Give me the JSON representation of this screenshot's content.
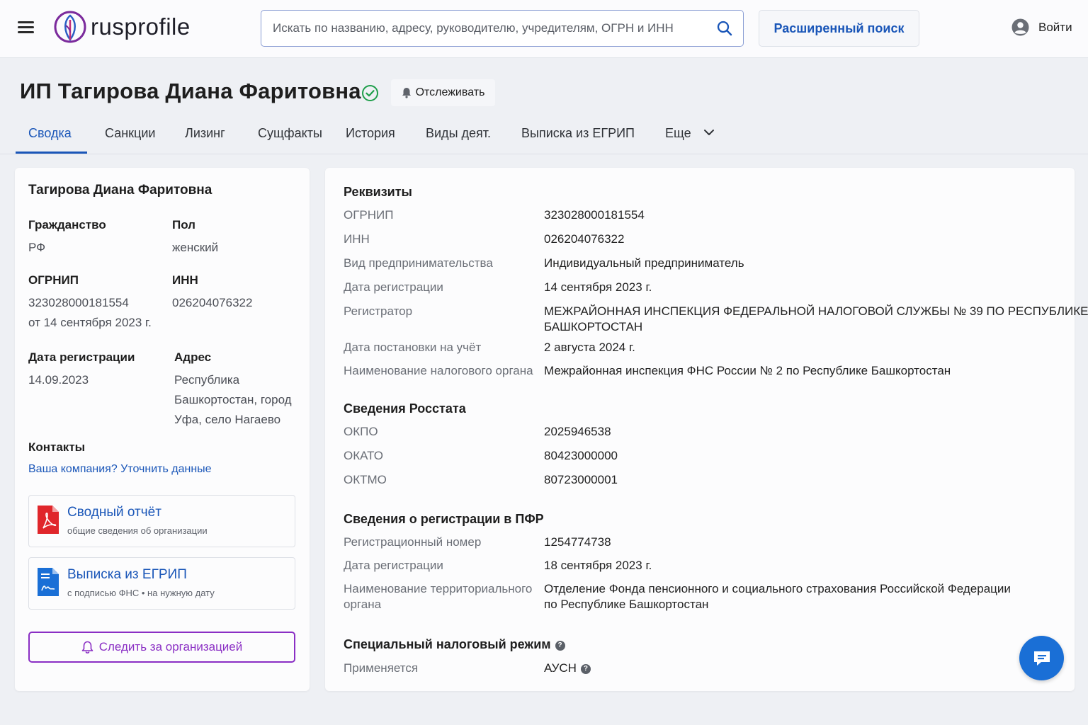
{
  "header": {
    "logo_text": "rusprofile",
    "search_placeholder": "Искать по названию, адресу, руководителю, учредителям, ОГРН и ИНН",
    "advanced_search_label": "Расширенный поиск",
    "login_label": "Войти"
  },
  "title": {
    "text": "ИП Тагирова Диана Фаритовна",
    "track_label": "Отслеживать"
  },
  "tabs": [
    "Сводка",
    "Санкции",
    "Лизинг",
    "Сущфакты",
    "История",
    "Виды деят.",
    "Выписка из ЕГРИП",
    "Еще"
  ],
  "summary": {
    "name": "Тагирова Диана Фаритовна",
    "citizenship_label": "Гражданство",
    "citizenship_value": "РФ",
    "gender_label": "Пол",
    "gender_value": "женский",
    "ogrnip_label": "ОГРНИП",
    "ogrnip_value": "323028000181554",
    "ogrnip_date": "от 14 сентября 2023 г.",
    "inn_label": "ИНН",
    "inn_value": "026204076322",
    "regdate_label": "Дата регистрации",
    "regdate_value": "14.09.2023",
    "address_label": "Адрес",
    "address_lines": [
      "Республика",
      "Башкортостан, город",
      "Уфа, село Нагаево"
    ],
    "contacts_label": "Контакты",
    "contacts_link": "Ваша компания? Уточнить данные",
    "report_title": "Сводный отчёт",
    "report_sub": "общие сведения об организации",
    "extract_title": "Выписка из ЕГРИП",
    "extract_sub": "с подписью ФНС • на нужную дату",
    "follow_label": "Следить за организацией"
  },
  "details": {
    "requisites_title": "Реквизиты",
    "requisites": [
      {
        "k": "ОГРНИП",
        "v": "323028000181554"
      },
      {
        "k": "ИНН",
        "v": "026204076322"
      },
      {
        "k": "Вид предпринимательства",
        "v": "Индивидуальный предприниматель"
      },
      {
        "k": "Дата регистрации",
        "v": "14 сентября 2023 г."
      },
      {
        "k": "Регистратор",
        "v1": "МЕЖРАЙОННАЯ ИНСПЕКЦИЯ ФЕДЕРАЛЬНОЙ НАЛОГОВОЙ СЛУЖБЫ № 39 ПО РЕСПУБЛИКЕ",
        "v2": "БАШКОРТОСТАН"
      },
      {
        "k": "Дата постановки на учёт",
        "v": "2 августа 2024 г."
      },
      {
        "k": "Наименование налогового органа",
        "v": "Межрайонная инспекция ФНС России № 2 по Республике Башкортостан"
      }
    ],
    "rosstat_title": "Сведения Росстата",
    "rosstat": [
      {
        "k": "ОКПО",
        "v": "2025946538"
      },
      {
        "k": "ОКАТО",
        "v": "80423000000"
      },
      {
        "k": "ОКТМО",
        "v": "80723000001"
      }
    ],
    "pfr_title": "Сведения о регистрации в ПФР",
    "pfr": [
      {
        "k": "Регистрационный номер",
        "v": "1254774738"
      },
      {
        "k": "Дата регистрации",
        "v": "18 сентября 2023 г."
      },
      {
        "k1": "Наименование территориального",
        "k2": "органа",
        "v1": "Отделение Фонда пенсионного и социального страхования Российской Федерации",
        "v2": "по Республике Башкортостан"
      }
    ],
    "tax_title": "Специальный налоговый режим",
    "tax_key": "Применяется",
    "tax_value": "АУСН"
  },
  "colors": {
    "accent": "#1a56b8",
    "follow": "#8a2ec4",
    "chat": "#1a6fd6",
    "verified": "#1e9e4a"
  },
  "icons": [
    "menu-icon",
    "logo-icon",
    "search-icon",
    "user-icon",
    "check-circle-icon",
    "bell-icon",
    "chevron-down-icon",
    "pdf-icon",
    "document-icon",
    "help-icon",
    "chat-icon"
  ]
}
